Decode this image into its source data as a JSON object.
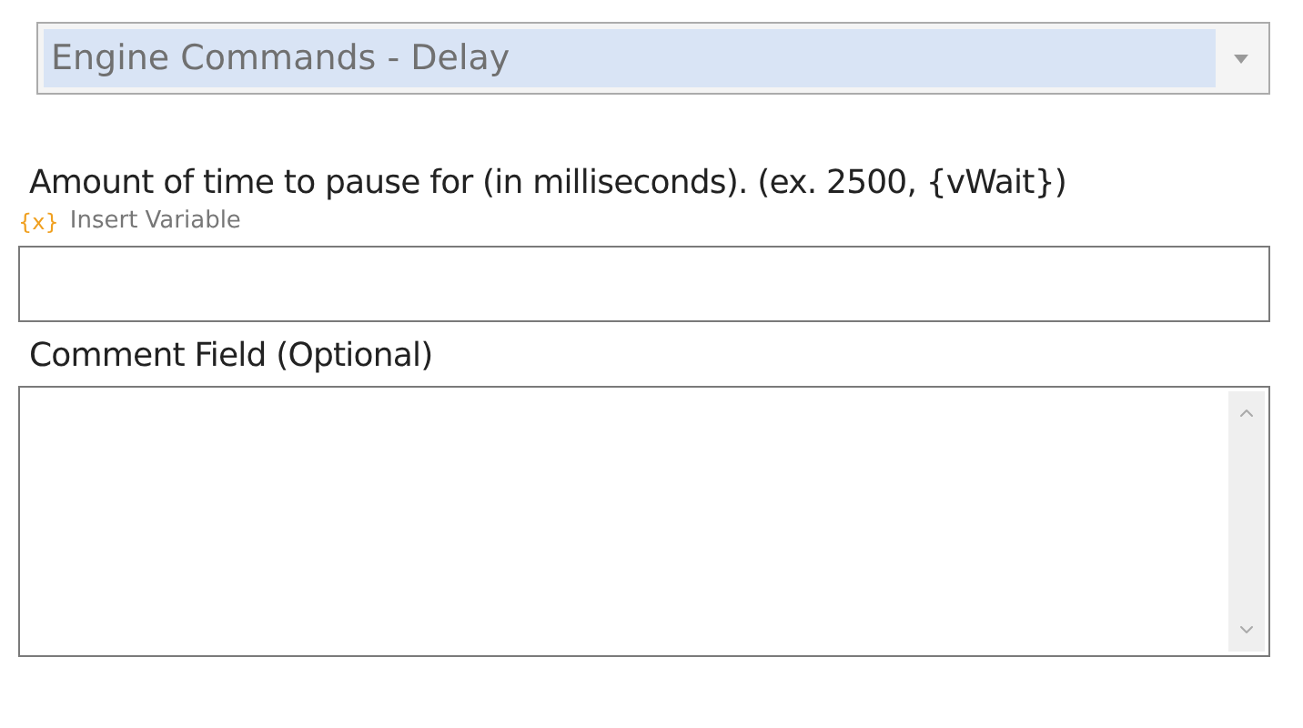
{
  "command_dropdown": {
    "value": "Engine Commands - Delay",
    "disabled": true
  },
  "delay_field": {
    "label": "Amount of time to pause for (in milliseconds). (ex. 2500, {vWait})",
    "insert_link": {
      "icon": "{x}",
      "label": "Insert Variable"
    }
  },
  "comment_field": {
    "label": "Comment Field (Optional)"
  }
}
